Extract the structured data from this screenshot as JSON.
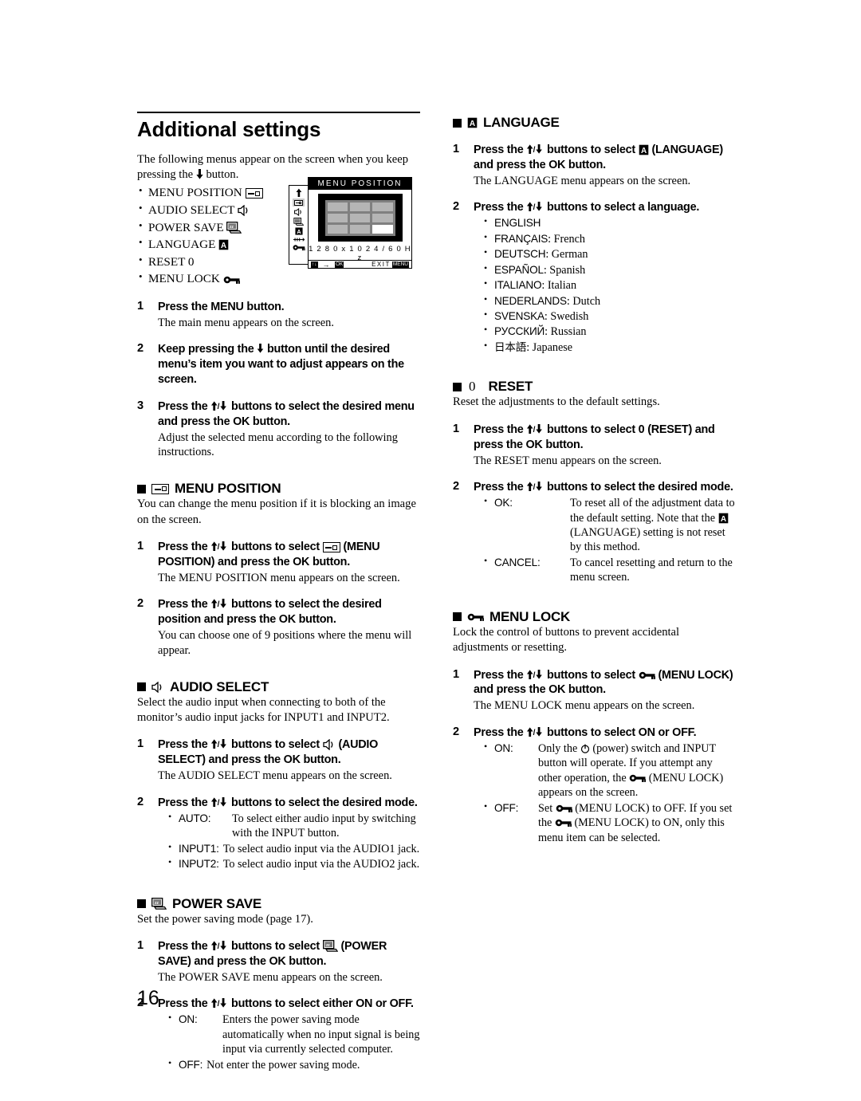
{
  "page": {
    "title": "Additional settings",
    "number": "16"
  },
  "intro": {
    "paragraph": "The following menus appear on the screen when you keep pressing the ↓ button.",
    "paragraph_part1": "The following menus appear on the screen when you keep",
    "paragraph_part2": "pressing the",
    "paragraph_part3": "button.",
    "items": [
      {
        "label": "MENU POSITION",
        "icon": "menu-position-icon"
      },
      {
        "label": "AUDIO SELECT",
        "icon": "speaker-icon"
      },
      {
        "label": "POWER SAVE",
        "icon": "power-save-icon"
      },
      {
        "label": "LANGUAGE",
        "icon": "language-icon"
      },
      {
        "label": "RESET 0",
        "icon": "none"
      },
      {
        "label": "MENU LOCK",
        "icon": "key-icon"
      }
    ]
  },
  "osd": {
    "title": "MENU POSITION",
    "resolution": "1 2 8 0 x 1 0 2 4 / 6 0 H z",
    "bar": {
      "updown_chip": "↑↓",
      "arrow": "→",
      "ok_chip": "OK",
      "exit_label": "EXIT",
      "menu_chip": "MENU"
    },
    "sidebar_icons": [
      "up-arrow-icon",
      "menu-position-icon",
      "speaker-icon",
      "power-save-icon",
      "language-icon",
      "reset-icon",
      "key-icon"
    ],
    "grid_cells": 9,
    "selected_cell_index": 8
  },
  "steps_intro": [
    {
      "num": "1",
      "lead": "Press the MENU button.",
      "sub": "The main menu appears on the screen."
    },
    {
      "num": "2",
      "lead_part1": "Keep pressing the",
      "lead_part2": "button until the desired menu’s item you want to adjust appears on the screen."
    },
    {
      "num": "3",
      "lead_part1": "Press the",
      "lead_part2": "buttons to select the desired menu and press the OK button.",
      "sub": "Adjust the selected menu according to the following instructions."
    }
  ],
  "sections": {
    "menu_position": {
      "heading": "MENU POSITION",
      "icon": "menu-position-icon",
      "intro": "You can change the menu position if it is blocking an image on the screen.",
      "steps": [
        {
          "num": "1",
          "lead_a": "Press the",
          "lead_b": "buttons to select",
          "lead_c": "(MENU POSITION) and press the OK button.",
          "sub": "The MENU POSITION menu appears on the screen."
        },
        {
          "num": "2",
          "lead_a": "Press the",
          "lead_b": "buttons to select the desired position and press the OK button.",
          "sub": "You can choose one of 9 positions where the menu will appear."
        }
      ]
    },
    "audio_select": {
      "heading": "AUDIO SELECT",
      "icon": "speaker-icon",
      "intro": "Select the audio input when connecting to both of the monitor’s audio input jacks for INPUT1 and INPUT2.",
      "steps": [
        {
          "num": "1",
          "lead_a": "Press the",
          "lead_b": "buttons to select",
          "lead_c": "(AUDIO SELECT) and press the OK button.",
          "sub": "The AUDIO SELECT menu appears on the screen."
        },
        {
          "num": "2",
          "lead_a": "Press the",
          "lead_b": "buttons to select the desired mode.",
          "options": [
            {
              "key": "AUTO:",
              "value": "To select either audio input by switching with the INPUT button."
            },
            {
              "key": "INPUT1:",
              "value": "To select audio input via the AUDIO1 jack."
            },
            {
              "key": "INPUT2:",
              "value": "To select audio input via the AUDIO2 jack."
            }
          ]
        }
      ]
    },
    "power_save": {
      "heading": "POWER SAVE",
      "icon": "power-save-icon",
      "intro": "Set the power saving mode (page 17).",
      "steps": [
        {
          "num": "1",
          "lead_a": "Press the",
          "lead_b": "buttons to select",
          "lead_c": "(POWER SAVE) and press the OK button.",
          "sub": "The POWER SAVE menu appears on the screen."
        },
        {
          "num": "2",
          "lead_a": "Press the",
          "lead_b": "buttons to select either ON or OFF.",
          "options": [
            {
              "key": "ON:",
              "value": "Enters the power saving mode automatically when no input signal is being input via currently selected computer."
            },
            {
              "key": "OFF:",
              "value": "Not enter the power saving mode."
            }
          ]
        }
      ]
    },
    "language": {
      "heading": "LANGUAGE",
      "icon": "language-icon",
      "steps": [
        {
          "num": "1",
          "lead_a": "Press the",
          "lead_b": "buttons to select",
          "lead_c": "(LANGUAGE) and press the OK button.",
          "sub": "The LANGUAGE menu appears on the screen."
        },
        {
          "num": "2",
          "lead_a": "Press the",
          "lead_b": "buttons to select a language.",
          "languages": [
            {
              "name": "ENGLISH",
              "gloss": ""
            },
            {
              "name": "FRANÇAIS",
              "gloss": ": French"
            },
            {
              "name": "DEUTSCH",
              "gloss": ": German"
            },
            {
              "name": "ESPAÑOL",
              "gloss": ": Spanish"
            },
            {
              "name": "ITALIANO",
              "gloss": ": Italian"
            },
            {
              "name": "NEDERLANDS",
              "gloss": ": Dutch"
            },
            {
              "name": "SVENSKA",
              "gloss": ": Swedish"
            },
            {
              "name": "РУССКИЙ",
              "gloss": ": Russian"
            },
            {
              "name": "日本語",
              "gloss": ": Japanese"
            }
          ]
        }
      ]
    },
    "reset": {
      "heading": "RESET",
      "icon": "zero-glyph",
      "zero": "0",
      "intro": "Reset the adjustments to the default settings.",
      "steps": [
        {
          "num": "1",
          "lead_a": "Press the",
          "lead_b": "buttons to select 0",
          "lead_c": "(RESET) and press the OK button.",
          "sub": "The RESET menu appears on the screen."
        },
        {
          "num": "2",
          "lead_a": "Press the",
          "lead_b": "buttons to select the desired mode.",
          "options": [
            {
              "key": "OK:",
              "value_a": "To reset all of the adjustment data to the default setting. Note that the",
              "value_b": "(LANGUAGE) setting is not reset by this method."
            },
            {
              "key": "CANCEL:",
              "value": "To cancel resetting and return to the menu screen."
            }
          ]
        }
      ]
    },
    "menu_lock": {
      "heading": "MENU LOCK",
      "icon": "key-icon",
      "intro": "Lock the control of buttons to prevent accidental adjustments or resetting.",
      "steps": [
        {
          "num": "1",
          "lead_a": "Press the",
          "lead_b": "buttons to select",
          "lead_c": "(MENU LOCK) and press the OK button.",
          "sub": "The MENU LOCK menu appears on the screen."
        },
        {
          "num": "2",
          "lead_a": "Press the",
          "lead_b": "buttons to select ON or OFF.",
          "options": [
            {
              "key": "ON:",
              "value_a": "Only the",
              "value_b": "(power) switch and INPUT button will operate. If you attempt any other operation, the",
              "value_c": "(MENU LOCK) appears on the screen."
            },
            {
              "key": "OFF:",
              "value_a": "Set",
              "value_b": "(MENU LOCK) to OFF. If you set the",
              "value_c": "(MENU LOCK) to ON, only this menu item can be selected."
            }
          ]
        }
      ]
    }
  },
  "glyphs": {
    "arrow_down": "↓",
    "arrow_up_down": "↑/↓"
  }
}
